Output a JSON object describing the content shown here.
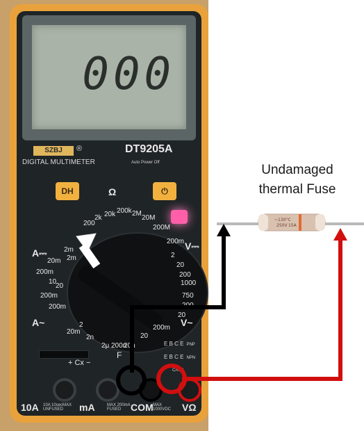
{
  "meter": {
    "display_value": "000",
    "brand": "SZBJ",
    "registered": "®",
    "model": "DT9205A",
    "subtitle": "DIGITAL MULTIMETER",
    "subtitle_small": "Auto Power Off",
    "btn_dh": "DH",
    "btn_power": "⏻",
    "ohm_symbol": "Ω",
    "dial_labels": [
      "200",
      "2k",
      "20k",
      "200k",
      "2M",
      "20M",
      "200M",
      "200m",
      "V⎓",
      "2",
      "20",
      "200",
      "1000",
      "750",
      "200",
      "20",
      "V~",
      "200m",
      "20",
      "2μ",
      "200n",
      "20n",
      "2n",
      "F",
      "20m",
      "2",
      "A~",
      "200m",
      "20",
      "2m",
      "A⎓",
      "2m",
      "20m",
      "200m",
      "10",
      "200m"
    ],
    "cx_label": "+ Cx −",
    "f_label": "F",
    "ebce_rows": [
      "E B C E",
      "E B C E"
    ],
    "pnp": "PNP",
    "npn": "NPN",
    "cat": "CAT II",
    "jacks": [
      "10A",
      "mA",
      "COM",
      "VΩ"
    ],
    "jack_small": [
      "10A 10secMAX UNFUSED",
      "MAX 200mA FUSED",
      "MAX 1000VDC"
    ]
  },
  "fuse": {
    "title_line1": "Undamaged",
    "title_line2": "thermal Fuse",
    "print": [
      "~130°C",
      "250V",
      "15A"
    ]
  },
  "colors": {
    "meter_body": "#e9a23b",
    "faceplate": "#1f2426",
    "lcd": "#a9b3a8",
    "led": "#ff5fa8",
    "wire_red": "#d10f0f",
    "wire_black": "#000000"
  }
}
